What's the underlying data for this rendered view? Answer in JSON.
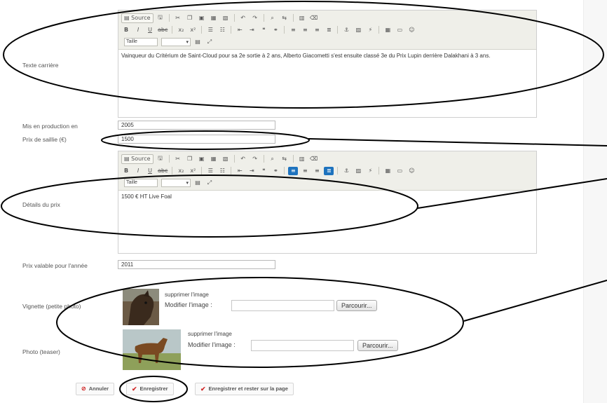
{
  "toolbar": {
    "source_label": "Source",
    "size_label": "Taille",
    "row1_icons": [
      "save-icon",
      "cut-icon",
      "copy-icon",
      "paste-icon",
      "paste-text-icon",
      "paste-word-icon",
      "undo-icon",
      "redo-icon",
      "find-icon",
      "replace-icon",
      "select-all-icon",
      "remove-format-icon"
    ],
    "row2_icons": [
      "bold-icon",
      "italic-icon",
      "underline-icon",
      "strike-icon",
      "subscript-icon",
      "superscript-icon",
      "numbered-list-icon",
      "bullet-list-icon",
      "outdent-icon",
      "indent-icon",
      "blockquote-icon",
      "link-icon",
      "align-left-icon",
      "align-center-icon",
      "align-right-icon",
      "justify-icon",
      "anchor-icon",
      "image-icon",
      "flash-icon",
      "table-icon",
      "hr-icon",
      "smiley-icon"
    ]
  },
  "fields": {
    "texte_carriere": {
      "label": "Texte carrière",
      "value": "Vainqueur du Critérium de Saint-Cloud pour sa 2e sortie à 2 ans, Alberto Giacometti s'est ensuite classé 3e du Prix Lupin derrière Dalakhani à 3 ans."
    },
    "mis_en_production": {
      "label": "Mis en production en",
      "value": "2005"
    },
    "prix_saillie": {
      "label": "Prix de saillie (€)",
      "value": "1500"
    },
    "details_prix": {
      "label": "Détails du prix",
      "value": "1500 € HT Live Foal"
    },
    "prix_valable": {
      "label": "Prix valable pour l'année",
      "value": "2011"
    },
    "vignette": {
      "label": "Vignette (petite photo)",
      "delete_label": "supprimer l'image",
      "modify_label": "Modifier l'image :",
      "browse_label": "Parcourir..."
    },
    "photo": {
      "label": "Photo (teaser)",
      "delete_label": "supprimer l'image",
      "modify_label": "Modifier l'image :",
      "browse_label": "Parcourir..."
    }
  },
  "actions": {
    "cancel_label": "Annuler",
    "save_label": "Enregistrer",
    "save_stay_label": "Enregistrer et rester sur la page"
  },
  "colors": {
    "annotation": "#000000",
    "accent_active": "#1e73be",
    "cancel_icon": "#d12b2b"
  }
}
